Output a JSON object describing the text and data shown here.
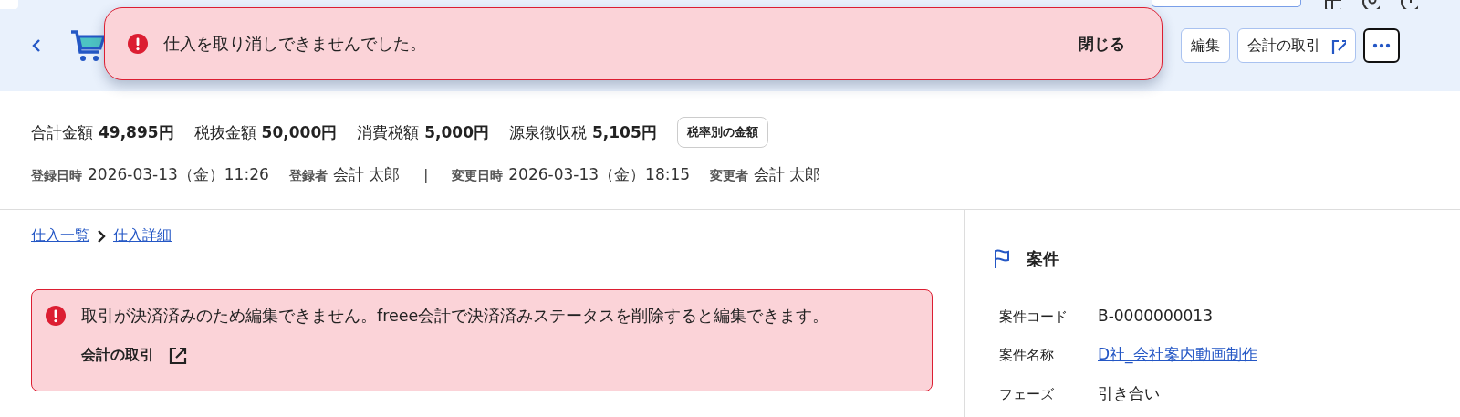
{
  "toast": {
    "message": "仕入を取り消しできませんでした。",
    "close_label": "閉じる"
  },
  "header_actions": [
    {
      "kind": "button",
      "label": "編集"
    },
    {
      "kind": "external",
      "label": "会計の取引"
    },
    {
      "kind": "more"
    }
  ],
  "amounts": [
    {
      "label": "合計金額",
      "value": "49,895円"
    },
    {
      "label": "税抜金額",
      "value": "50,000円"
    },
    {
      "label": "消費税額",
      "value": "5,000円"
    },
    {
      "label": "源泉徴収税",
      "value": "5,105円"
    }
  ],
  "tax_rate_button": "税率別の金額",
  "meta": [
    {
      "label": "登録日時",
      "value": "2026-03-13（金）11:26"
    },
    {
      "label": "登録者",
      "value": "会計 太郎"
    },
    {
      "label": "変更日時",
      "value": "2026-03-13（金）18:15"
    },
    {
      "label": "変更者",
      "value": "会計 太郎"
    }
  ],
  "meta_separator": "|",
  "breadcrumb": [
    "仕入一覧",
    "仕入詳細"
  ],
  "alert": {
    "message": "取引が決済済みのため編集できません。freee会計で決済済みステータスを削除すると編集できます。",
    "link": "会計の取引"
  },
  "project": {
    "title": "案件",
    "fields": [
      {
        "label": "案件コード",
        "value": "B-0000000013",
        "kind": "text"
      },
      {
        "label": "案件名称",
        "value": "D社_会社案内動画制作",
        "kind": "link"
      },
      {
        "label": "フェーズ",
        "value": "引き合い",
        "kind": "text"
      }
    ]
  }
}
